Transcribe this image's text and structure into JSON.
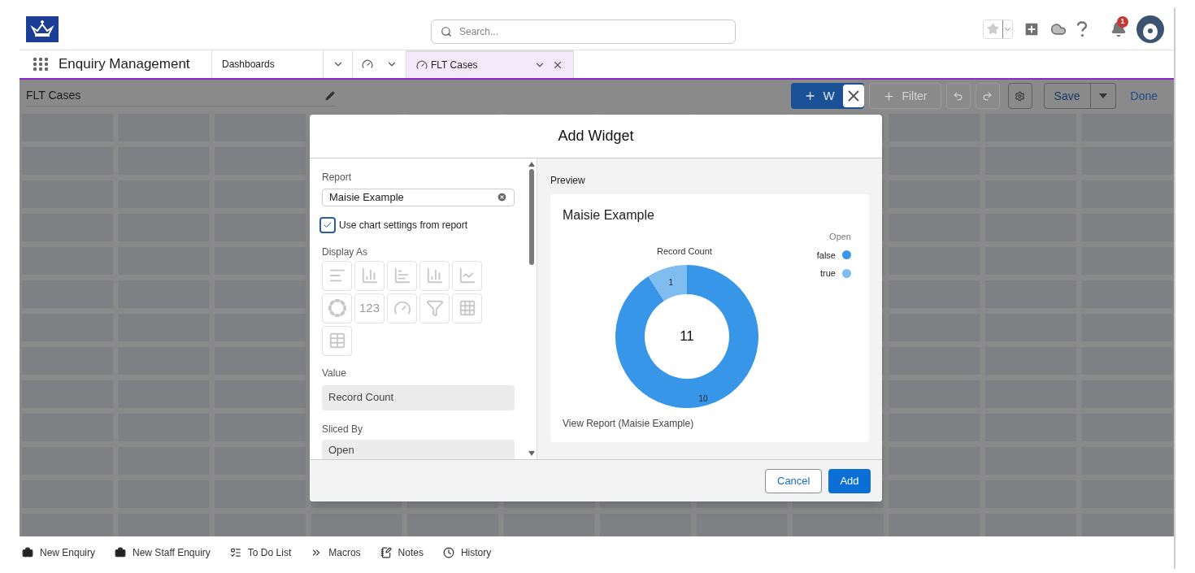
{
  "header": {
    "search": {
      "placeholder": "Search..."
    },
    "notifications": {
      "badge": "1"
    }
  },
  "nav": {
    "app_name": "Enquiry Management",
    "tabs": [
      {
        "kind": "menu",
        "label": "Dashboards",
        "selected": false
      },
      {
        "kind": "icon",
        "selected": false
      },
      {
        "kind": "record",
        "label": "FLT Cases",
        "selected": true
      }
    ]
  },
  "dashboard": {
    "title": "FLT Cases",
    "toolbar": [
      {
        "kind": "primary",
        "label": "W",
        "disabled": false
      },
      {
        "kind": "plus",
        "label": "Filter",
        "disabled": true
      },
      {
        "kind": "undo",
        "disabled": true
      },
      {
        "kind": "redo",
        "disabled": true
      },
      {
        "kind": "gear",
        "disabled": false
      },
      {
        "kind": "split",
        "label": "Save",
        "disabled": false
      },
      {
        "kind": "link",
        "label": "Done",
        "disabled": false
      }
    ]
  },
  "modal": {
    "title": "Add Widget",
    "report": {
      "label": "Report",
      "value": "Maisie Example"
    },
    "use_chart_settings": {
      "label": "Use chart settings from report",
      "checked": true
    },
    "display_as": {
      "label": "Display As",
      "disabled": true,
      "options": [
        {
          "kind": "hbar"
        },
        {
          "kind": "vbar"
        },
        {
          "kind": "hstack"
        },
        {
          "kind": "vstack"
        },
        {
          "kind": "line"
        },
        {
          "kind": "donut"
        },
        {
          "kind": "metric",
          "label": "123"
        },
        {
          "kind": "gauge"
        },
        {
          "kind": "funnel"
        },
        {
          "kind": "scatter"
        },
        {
          "kind": "table"
        }
      ]
    },
    "value": {
      "label": "Value",
      "value": "Record Count"
    },
    "sliced_by": {
      "label": "Sliced By",
      "value": "Open"
    },
    "preview": {
      "label": "Preview",
      "card_title": "Maisie Example",
      "center_total": "11",
      "link": "View Report (Maisie Example)",
      "chart_data": {
        "type": "donut",
        "title": "Record Count",
        "categories": [
          "false",
          "true"
        ],
        "series": [
          {
            "name": "Open",
            "values": [
              10,
              1
            ]
          }
        ],
        "colors": [
          "#3896e8",
          "#7fbcf0"
        ],
        "data_labels": true
      }
    },
    "buttons": [
      {
        "kind": "neutral",
        "label": "Cancel"
      },
      {
        "kind": "brand",
        "label": "Add"
      }
    ]
  },
  "utility_bar": [
    {
      "kind": "briefcase",
      "label": "New Enquiry"
    },
    {
      "kind": "briefcase",
      "label": "New Staff Enquiry"
    },
    {
      "kind": "todo",
      "label": "To Do List"
    },
    {
      "kind": "macros",
      "label": "Macros"
    },
    {
      "kind": "notes",
      "label": "Notes"
    },
    {
      "kind": "history",
      "label": "History"
    }
  ]
}
